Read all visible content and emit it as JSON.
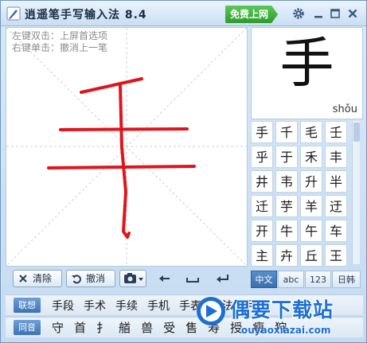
{
  "titlebar": {
    "title": "逍遥笔手写输入法 8.4",
    "free_label": "免费上网"
  },
  "pad": {
    "hint_line1": "左键双击：上屏首选项",
    "hint_line2": "右键单击：撤消上一笔"
  },
  "toolbar": {
    "clear_label": "清除",
    "undo_label": "撤消"
  },
  "preview": {
    "char": "手",
    "pinyin": "shǒu"
  },
  "candidates": [
    [
      "手",
      "千",
      "毛",
      "壬"
    ],
    [
      "乎",
      "于",
      "禾",
      "丰"
    ],
    [
      "井",
      "韦",
      "升",
      "半"
    ],
    [
      "迁",
      "芋",
      "羊",
      "迂"
    ],
    [
      "开",
      "牛",
      "午",
      "车"
    ],
    [
      "主",
      "卉",
      "丘",
      "王"
    ]
  ],
  "modes": [
    "中文",
    "abc",
    "123",
    "日韩"
  ],
  "active_mode": "中文",
  "association": {
    "tag": "联想",
    "items": [
      "手段",
      "手术",
      "手续",
      "手机",
      "手表",
      "手法",
      "手枪"
    ]
  },
  "homophone": {
    "tag": "同音",
    "items": [
      "守",
      "首",
      "扌",
      "艏",
      "兽",
      "受",
      "售",
      "寿",
      "授",
      "瘦",
      "狩"
    ]
  },
  "watermark": {
    "text": "偶要下载站",
    "url": "ouyaoxiazai.com"
  },
  "colors": {
    "accent": "#3d73b4",
    "ink": "#e0151c",
    "free_button": "#2e9a2c",
    "watermark": "#1d6fd2"
  }
}
